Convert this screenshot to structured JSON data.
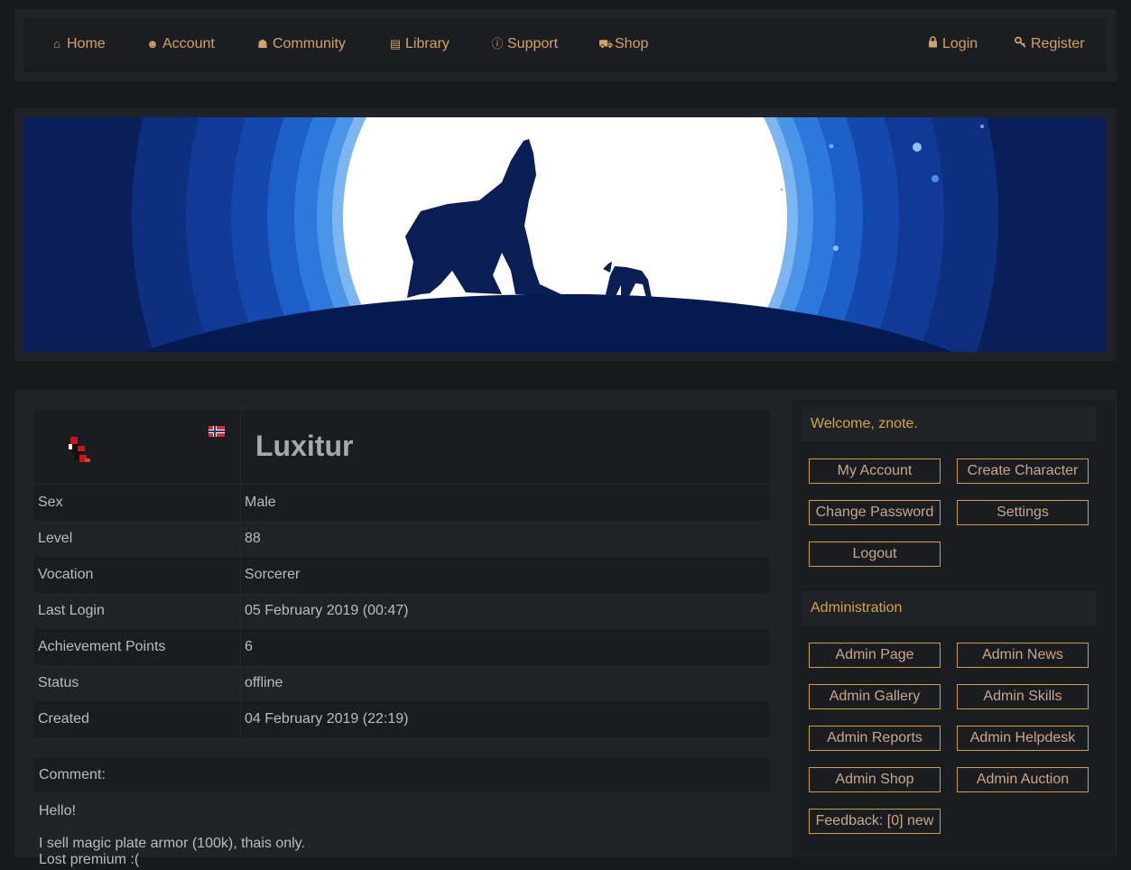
{
  "nav": {
    "left": [
      {
        "label": "Home",
        "icon": "home-icon",
        "glyph": "⌂"
      },
      {
        "label": "Account",
        "icon": "user-circle-icon",
        "glyph": "☻"
      },
      {
        "label": "Community",
        "icon": "users-icon",
        "glyph": "👥"
      },
      {
        "label": "Library",
        "icon": "book-icon",
        "glyph": "📖"
      },
      {
        "label": "Support",
        "icon": "info-icon",
        "glyph": "ℹ"
      },
      {
        "label": "Shop",
        "icon": "cart-icon",
        "glyph": "🛒"
      }
    ],
    "right": [
      {
        "label": "Login",
        "icon": "lock-icon",
        "glyph": "🔒"
      },
      {
        "label": "Register",
        "icon": "key-icon",
        "glyph": "🔑"
      }
    ]
  },
  "character": {
    "name": "Luxitur",
    "flag": "norway-flag-icon",
    "fields": [
      {
        "key": "Sex",
        "value": "Male"
      },
      {
        "key": "Level",
        "value": "88"
      },
      {
        "key": "Vocation",
        "value": "Sorcerer"
      },
      {
        "key": "Last Login",
        "value": "05 February 2019 (00:47)"
      },
      {
        "key": "Achievement Points",
        "value": "6"
      },
      {
        "key": "Status",
        "value": "offline"
      },
      {
        "key": "Created",
        "value": "04 February 2019 (22:19)"
      }
    ],
    "comment_label": "Comment:",
    "comment_lines": [
      "Hello!",
      "I sell magic plate armor (100k), thais only.",
      "Lost premium :("
    ]
  },
  "sidebar": {
    "welcome": "Welcome, znote.",
    "account_buttons": [
      "My Account",
      "Create Character",
      "Change Password",
      "Settings",
      "Logout"
    ],
    "admin_title": "Administration",
    "admin_buttons": [
      "Admin Page",
      "Admin News",
      "Admin Gallery",
      "Admin Skills",
      "Admin Reports",
      "Admin Helpdesk",
      "Admin Shop",
      "Admin Auction",
      "Feedback: [0] new"
    ]
  },
  "colors": {
    "background": "#17191d",
    "panel": "#1f2227",
    "accent": "#d1a366",
    "button_border": "#c9a04b",
    "title_gold": "#d7a53a"
  }
}
